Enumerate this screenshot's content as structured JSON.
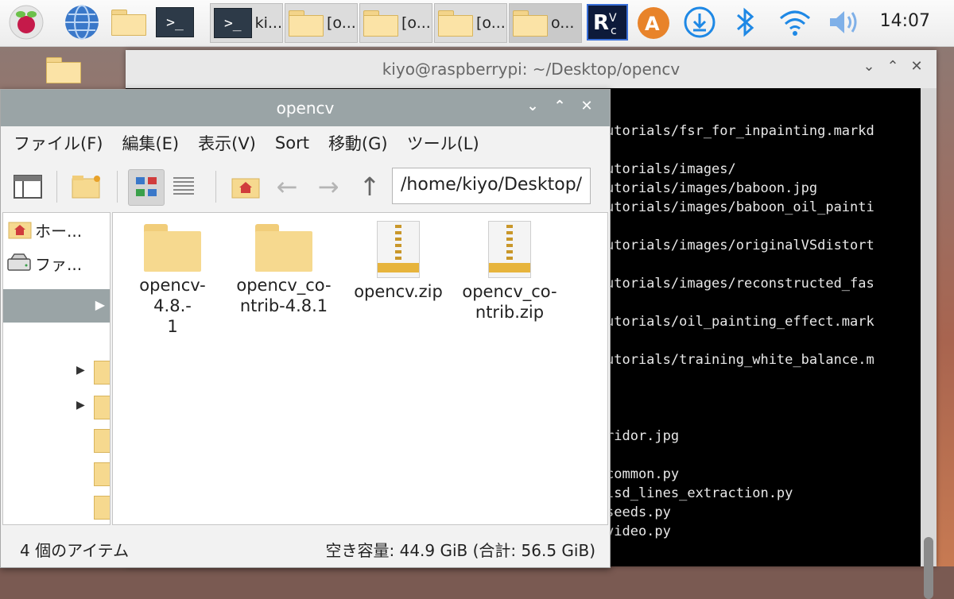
{
  "taskbar": {
    "tasks": [
      {
        "label": "ki..."
      },
      {
        "label": "[o..."
      },
      {
        "label": "[o..."
      },
      {
        "label": "[o..."
      },
      {
        "label": "o..."
      }
    ],
    "clock": "14:07"
  },
  "terminal": {
    "title": "kiyo@raspberrypi: ~/Desktop/opencv",
    "lines": [
      "utorials/fsr_for_inpainting.markd",
      "utorials/images/",
      "utorials/images/baboon.jpg",
      "utorials/images/baboon_oil_painti",
      "utorials/images/originalVSdistort",
      "utorials/images/reconstructed_fas",
      "utorials/oil_painting_effect.mark",
      "utorials/training_white_balance.m",
      "ridor.jpg",
      "common.py",
      "lsd_lines_extraction.py",
      "seeds.py",
      "video.py"
    ]
  },
  "file_manager": {
    "title": "opencv",
    "menu": [
      "ファイル(F)",
      "編集(E)",
      "表示(V)",
      "Sort",
      "移動(G)",
      "ツール(L)"
    ],
    "path": "/home/kiyo/Desktop/",
    "sidebar": [
      {
        "label": "ホー..."
      },
      {
        "label": "ファ..."
      }
    ],
    "files": [
      {
        "name_l1": "opencv-4.8.-",
        "name_l2": "1"
      },
      {
        "name_l1": "opencv_co-",
        "name_l2": "ntrib-4.8.1"
      },
      {
        "name_l1": "opencv.zip",
        "name_l2": ""
      },
      {
        "name_l1": "opencv_co-",
        "name_l2": "ntrib.zip"
      }
    ],
    "status_left": "4 個のアイテム",
    "status_right": "空き容量: 44.9 GiB (合計: 56.5 GiB)"
  }
}
